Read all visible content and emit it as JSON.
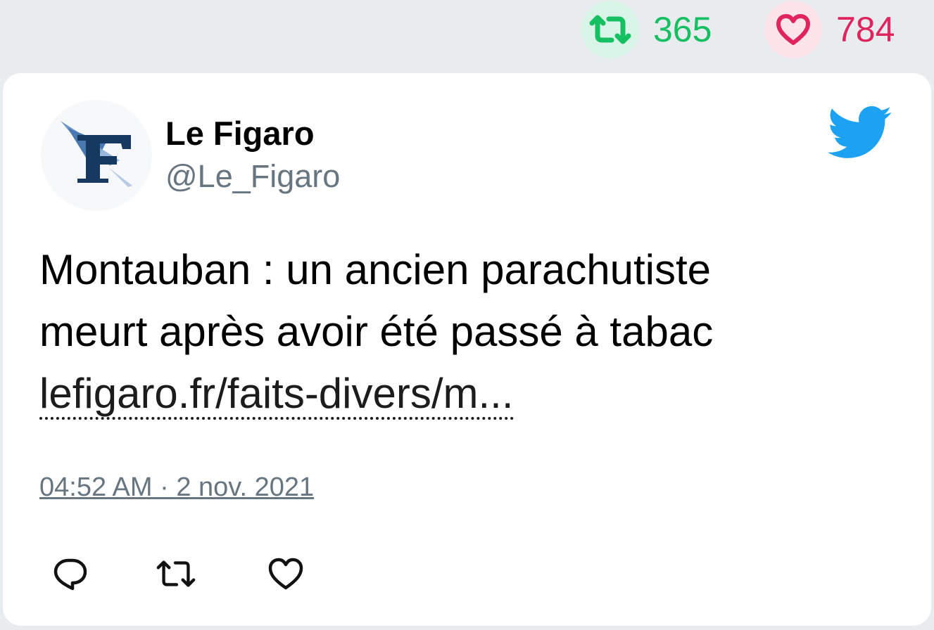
{
  "stats": {
    "retweet_count": "365",
    "like_count": "784"
  },
  "tweet": {
    "author_name": "Le Figaro",
    "author_handle": "@Le_Figaro",
    "text_line_1": "Montauban : un ancien parachutiste",
    "text_line_2": "meurt après avoir été passé à tabac",
    "link_text": "lefigaro.fr/faits-divers/m...",
    "timestamp": "04:52 AM · 2 nov. 2021"
  },
  "icons": {
    "retweet": "retweet-icon",
    "like": "heart-icon",
    "reply": "reply-icon",
    "brand": "twitter-bird-icon",
    "avatar": "le-figaro-logo"
  },
  "colors": {
    "retweet": "#17bf63",
    "like": "#e0245e",
    "twitter_blue": "#1da1f2",
    "muted": "#66757f"
  }
}
